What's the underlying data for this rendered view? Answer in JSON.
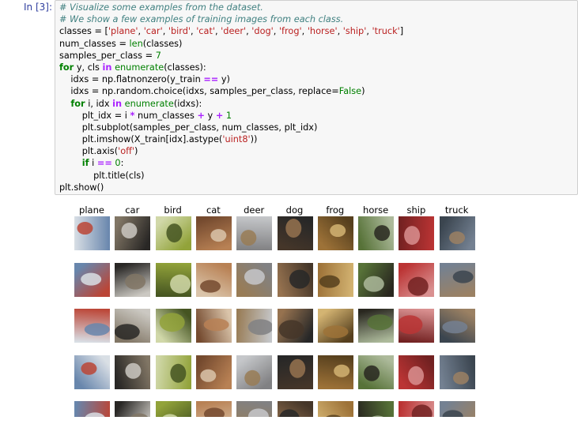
{
  "cell": {
    "prompt": "In [3]:",
    "code_lines": [
      [
        {
          "t": "# Visualize some examples from the dataset.",
          "c": "cm"
        }
      ],
      [
        {
          "t": "# We show a few examples of training images from each class.",
          "c": "cm"
        }
      ],
      [
        {
          "t": "classes = [",
          "c": ""
        },
        {
          "t": "'plane'",
          "c": "st"
        },
        {
          "t": ", ",
          "c": ""
        },
        {
          "t": "'car'",
          "c": "st"
        },
        {
          "t": ", ",
          "c": ""
        },
        {
          "t": "'bird'",
          "c": "st"
        },
        {
          "t": ", ",
          "c": ""
        },
        {
          "t": "'cat'",
          "c": "st"
        },
        {
          "t": ", ",
          "c": ""
        },
        {
          "t": "'deer'",
          "c": "st"
        },
        {
          "t": ", ",
          "c": ""
        },
        {
          "t": "'dog'",
          "c": "st"
        },
        {
          "t": ", ",
          "c": ""
        },
        {
          "t": "'frog'",
          "c": "st"
        },
        {
          "t": ", ",
          "c": ""
        },
        {
          "t": "'horse'",
          "c": "st"
        },
        {
          "t": ", ",
          "c": ""
        },
        {
          "t": "'ship'",
          "c": "st"
        },
        {
          "t": ", ",
          "c": ""
        },
        {
          "t": "'truck'",
          "c": "st"
        },
        {
          "t": "]",
          "c": ""
        }
      ],
      [
        {
          "t": "num_classes = ",
          "c": ""
        },
        {
          "t": "len",
          "c": "bi"
        },
        {
          "t": "(classes)",
          "c": ""
        }
      ],
      [
        {
          "t": "samples_per_class = ",
          "c": ""
        },
        {
          "t": "7",
          "c": "nm"
        }
      ],
      [
        {
          "t": "for",
          "c": "kw"
        },
        {
          "t": " y, cls ",
          "c": ""
        },
        {
          "t": "in",
          "c": "op"
        },
        {
          "t": " ",
          "c": ""
        },
        {
          "t": "enumerate",
          "c": "bi"
        },
        {
          "t": "(classes):",
          "c": ""
        }
      ],
      [
        {
          "t": "    idxs = np.flatnonzero(y_train ",
          "c": ""
        },
        {
          "t": "==",
          "c": "op"
        },
        {
          "t": " y)",
          "c": ""
        }
      ],
      [
        {
          "t": "    idxs = np.random.choice(idxs, samples_per_class, replace=",
          "c": ""
        },
        {
          "t": "False",
          "c": "bi"
        },
        {
          "t": ")",
          "c": ""
        }
      ],
      [
        {
          "t": "    ",
          "c": ""
        },
        {
          "t": "for",
          "c": "kw"
        },
        {
          "t": " i, idx ",
          "c": ""
        },
        {
          "t": "in",
          "c": "op"
        },
        {
          "t": " ",
          "c": ""
        },
        {
          "t": "enumerate",
          "c": "bi"
        },
        {
          "t": "(idxs):",
          "c": ""
        }
      ],
      [
        {
          "t": "        plt_idx = i ",
          "c": ""
        },
        {
          "t": "*",
          "c": "op"
        },
        {
          "t": " num_classes ",
          "c": ""
        },
        {
          "t": "+",
          "c": "op"
        },
        {
          "t": " y ",
          "c": ""
        },
        {
          "t": "+",
          "c": "op"
        },
        {
          "t": " ",
          "c": ""
        },
        {
          "t": "1",
          "c": "nm"
        }
      ],
      [
        {
          "t": "        plt.subplot(samples_per_class, num_classes, plt_idx)",
          "c": ""
        }
      ],
      [
        {
          "t": "        plt.imshow(X_train[idx].astype(",
          "c": ""
        },
        {
          "t": "'uint8'",
          "c": "st"
        },
        {
          "t": "))",
          "c": ""
        }
      ],
      [
        {
          "t": "        plt.axis(",
          "c": ""
        },
        {
          "t": "'off'",
          "c": "st"
        },
        {
          "t": ")",
          "c": ""
        }
      ],
      [
        {
          "t": "        ",
          "c": ""
        },
        {
          "t": "if",
          "c": "kw"
        },
        {
          "t": " i ",
          "c": ""
        },
        {
          "t": "==",
          "c": "op"
        },
        {
          "t": " ",
          "c": ""
        },
        {
          "t": "0",
          "c": "nm"
        },
        {
          "t": ":",
          "c": ""
        }
      ],
      [
        {
          "t": "            plt.title(cls)",
          "c": ""
        }
      ],
      [
        {
          "t": "plt.show()",
          "c": ""
        }
      ]
    ]
  },
  "output": {
    "class_titles": [
      "plane",
      "car",
      "bird",
      "cat",
      "deer",
      "dog",
      "frog",
      "horse",
      "ship",
      "truck"
    ],
    "thumb_palettes": [
      [
        "#6f8fb8",
        "#c84a3a",
        "#e8eef5"
      ],
      [
        "#2c2a28",
        "#d9d6cf",
        "#8a7e6c"
      ],
      [
        "#9cae3e",
        "#4a5a24",
        "#dfe7b5"
      ],
      [
        "#c58a5a",
        "#e9d2b6",
        "#7c4f32"
      ],
      [
        "#8a8a8c",
        "#a3855c",
        "#d3d5d8"
      ],
      [
        "#4a3a2c",
        "#a07a55",
        "#2a2a2a"
      ],
      [
        "#a87a3c",
        "#e2c07a",
        "#5c4420"
      ],
      [
        "#5d7a3c",
        "#2c2a22",
        "#b9c7a6"
      ],
      [
        "#c83838",
        "#e89a9a",
        "#7a2424"
      ],
      [
        "#7c8a9c",
        "#a68a6a",
        "#3f4a55"
      ]
    ],
    "rows": 5
  }
}
